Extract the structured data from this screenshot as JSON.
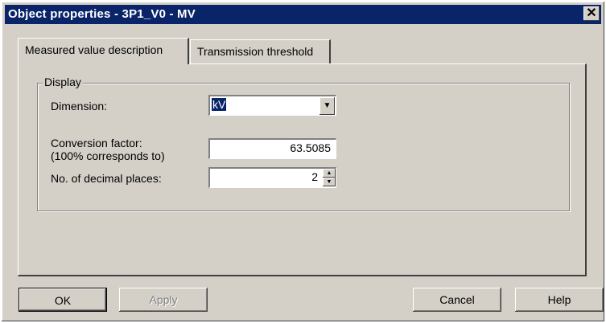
{
  "window": {
    "title": "Object properties - 3P1_V0 - MV",
    "close_symbol": "✕"
  },
  "tabs": [
    {
      "label": "Measured value description",
      "active": true
    },
    {
      "label": "Transmission threshold",
      "active": false
    }
  ],
  "display_group": {
    "title": "Display",
    "dimension": {
      "label": "Dimension:",
      "value": "kV"
    },
    "conversion_factor": {
      "label_line1": "Conversion factor:",
      "label_line2": "(100% corresponds to)",
      "value": "63.5085"
    },
    "decimal_places": {
      "label": "No. of decimal places:",
      "value": "2"
    }
  },
  "buttons": {
    "ok": "OK",
    "apply": "Apply",
    "cancel": "Cancel",
    "help": "Help"
  },
  "colors": {
    "title_bar": "#0a246a",
    "face": "#d4d0c8"
  }
}
